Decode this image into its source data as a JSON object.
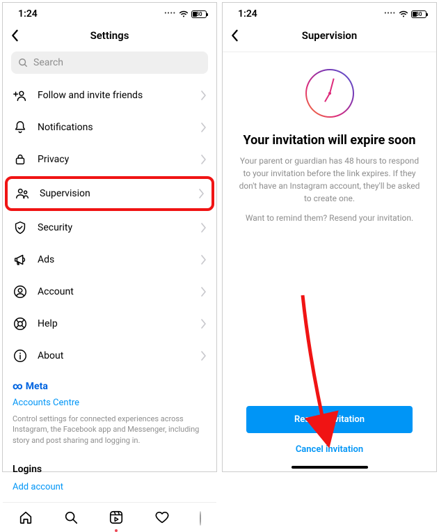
{
  "status": {
    "time": "1:24",
    "battery": "30"
  },
  "left": {
    "title": "Settings",
    "search_placeholder": "Search",
    "items": {
      "invite": "Follow and invite friends",
      "notifications": "Notifications",
      "privacy": "Privacy",
      "supervision": "Supervision",
      "security": "Security",
      "ads": "Ads",
      "account": "Account",
      "help": "Help",
      "about": "About"
    },
    "meta_logo": "Meta",
    "accounts_centre": "Accounts Centre",
    "meta_desc": "Control settings for connected experiences across Instagram, the Facebook app and Messenger, including story and post sharing and logging in.",
    "logins": "Logins",
    "add_account": "Add account"
  },
  "right": {
    "title": "Supervision",
    "heading": "Your invitation will expire soon",
    "para1": "Your parent or guardian has 48 hours to respond to your invitation before the link expires. If they don't have an Instagram account, they'll be asked to create one.",
    "para2": "Want to remind them? Resend your invitation.",
    "resend": "Resend invitation",
    "cancel": "Cancel invitation"
  }
}
